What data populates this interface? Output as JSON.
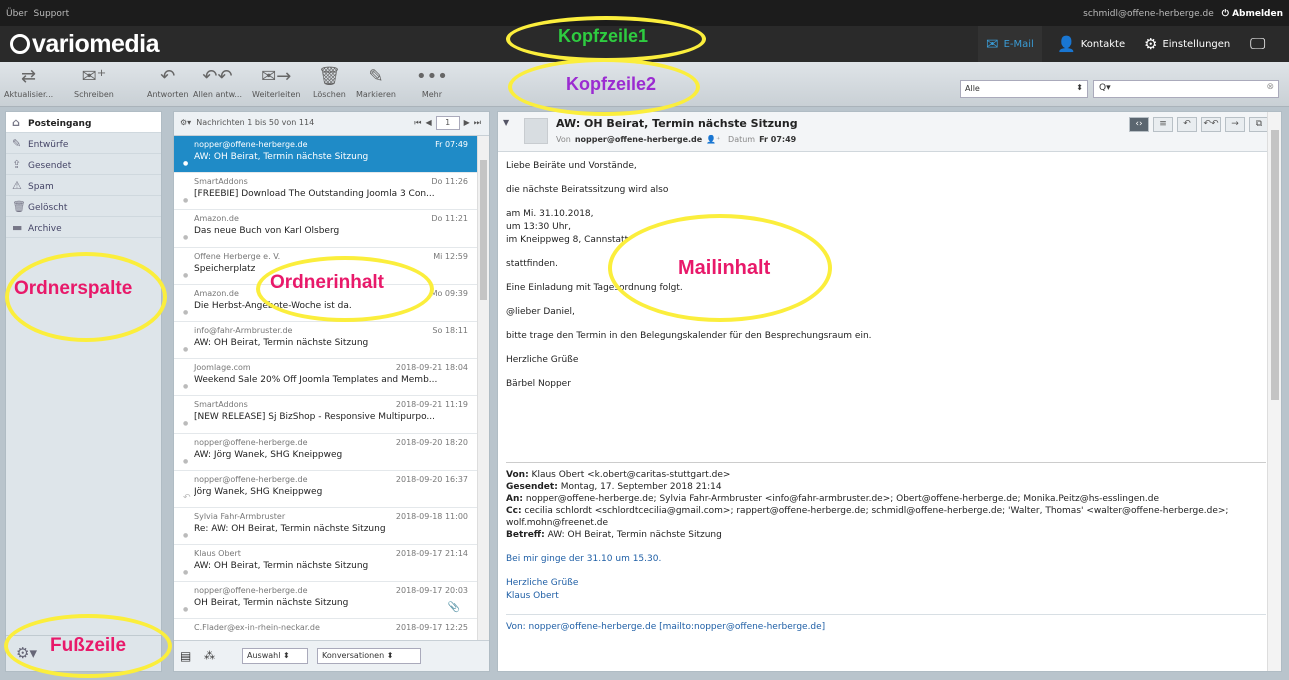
{
  "topbar": {
    "links": [
      "Über",
      "Support"
    ],
    "user": "schmidl@offene-herberge.de",
    "logout": "Abmelden"
  },
  "brand": {
    "logo": "variomedia"
  },
  "nav": {
    "mail": "E-Mail",
    "contacts": "Kontakte",
    "settings": "Einstellungen"
  },
  "toolbar": {
    "refresh": "Aktualisier...",
    "compose": "Schreiben",
    "reply": "Antworten",
    "reply_all": "Allen antw...",
    "forward": "Weiterleiten",
    "delete": "Löschen",
    "mark": "Markieren",
    "more": "Mehr"
  },
  "filter": {
    "value": "Alle"
  },
  "search": {
    "icon_label": "Q▾"
  },
  "folders": [
    {
      "label": "Posteingang",
      "icon": "inbox-icon",
      "selected": true
    },
    {
      "label": "Entwürfe",
      "icon": "pencil-icon"
    },
    {
      "label": "Gesendet",
      "icon": "sent-icon"
    },
    {
      "label": "Spam",
      "icon": "spam-icon"
    },
    {
      "label": "Gelöscht",
      "icon": "trash-icon"
    },
    {
      "label": "Archive",
      "icon": "archive-icon"
    }
  ],
  "list": {
    "count_text": "Nachrichten 1 bis 50 von 114",
    "page": "1",
    "messages": [
      {
        "from": "nopper@offene-herberge.de",
        "date": "Fr 07:49",
        "subject": "AW: OH Beirat, Termin nächste Sitzung",
        "selected": true
      },
      {
        "from": "SmartAddons",
        "date": "Do 11:26",
        "subject": "[FREEBIE] Download The Outstanding Joomla 3 Con..."
      },
      {
        "from": "Amazon.de",
        "date": "Do 11:21",
        "subject": "Das neue Buch von Karl Olsberg"
      },
      {
        "from": "Offene Herberge e. V.",
        "date": "Mi 12:59",
        "subject": "Speicherplatz"
      },
      {
        "from": "Amazon.de",
        "date": "Mo 09:39",
        "subject": "Die Herbst-Angebote-Woche ist da."
      },
      {
        "from": "info@fahr-Armbruster.de",
        "date": "So 18:11",
        "subject": "AW: OH Beirat, Termin nächste Sitzung"
      },
      {
        "from": "Joomlage.com",
        "date": "2018-09-21 18:04",
        "subject": "Weekend Sale 20% Off Joomla Templates and Memb..."
      },
      {
        "from": "SmartAddons",
        "date": "2018-09-21 11:19",
        "subject": "[NEW RELEASE] Sj BizShop - Responsive Multipurpo..."
      },
      {
        "from": "nopper@offene-herberge.de",
        "date": "2018-09-20 18:20",
        "subject": "AW: Jörg Wanek, SHG Kneippweg"
      },
      {
        "from": "nopper@offene-herberge.de",
        "date": "2018-09-20 16:37",
        "subject": "Jörg Wanek, SHG Kneippweg",
        "replied": true
      },
      {
        "from": "Sylvia Fahr-Armbruster",
        "date": "2018-09-18 11:00",
        "subject": "Re: AW: OH Beirat, Termin nächste Sitzung"
      },
      {
        "from": "Klaus Obert",
        "date": "2018-09-17 21:14",
        "subject": "AW: OH Beirat, Termin nächste Sitzung"
      },
      {
        "from": "nopper@offene-herberge.de",
        "date": "2018-09-17 20:03",
        "subject": "OH Beirat, Termin nächste Sitzung",
        "attachment": true
      },
      {
        "from": "C.Flader@ex-in-rhein-neckar.de",
        "date": "2018-09-17 12:25",
        "subject": ""
      }
    ],
    "footer": {
      "select": "Auswahl",
      "threads": "Konversationen"
    }
  },
  "mail": {
    "subject": "AW: OH Beirat, Termin nächste Sitzung",
    "from_label": "Von",
    "from": "nopper@offene-herberge.de",
    "date_label": "Datum",
    "date": "Fr 07:49",
    "body": [
      "Liebe Beiräte und Vorstände,",
      "die nächste Beiratssitzung wird also",
      "am Mi. 31.10.2018,",
      "um 13:30 Uhr,",
      "im Kneippweg 8, Cannstatt",
      "stattfinden.",
      "Eine Einladung mit Tagesordnung folgt.",
      "@lieber Daniel,",
      "bitte trage den Termin in den Belegungskalender für den Besprechungsraum ein.",
      "Herzliche Grüße",
      "Bärbel Nopper"
    ],
    "quote": {
      "from_label": "Von:",
      "from": "Klaus Obert <k.obert@caritas-stuttgart.de>",
      "sent_label": "Gesendet:",
      "sent": "Montag, 17. September 2018 21:14",
      "to_label": "An:",
      "to": "nopper@offene-herberge.de; Sylvia Fahr-Armbruster <info@fahr-armbruster.de>; Obert@offene-herberge.de; Monika.Peitz@hs-esslingen.de",
      "cc_label": "Cc:",
      "cc": "cecilia schlordt <schlordtcecilia@gmail.com>; rappert@offene-herberge.de; schmidl@offene-herberge.de; 'Walter, Thomas' <walter@offene-herberge.de>; wolf.mohn@freenet.de",
      "subject_label": "Betreff:",
      "subject": "AW: OH Beirat, Termin nächste Sitzung",
      "line1": "Bei mir ginge der 31.10 um 15.30.",
      "line2": "Herzliche Grüße",
      "line3": "Klaus Obert",
      "bottom_from": "Von: nopper@offene-herberge.de [mailto:nopper@offene-herberge.de]"
    }
  },
  "annotations": {
    "header1": "Kopfzeile1",
    "header2": "Kopfzeile2",
    "folders": "Ordnerspalte",
    "list": "Ordnerinhalt",
    "mail": "Mailinhalt",
    "footer": "Fußzeile"
  },
  "colors": {
    "accent": "#1f8bc7",
    "annotation_ring": "#fbee3c"
  }
}
